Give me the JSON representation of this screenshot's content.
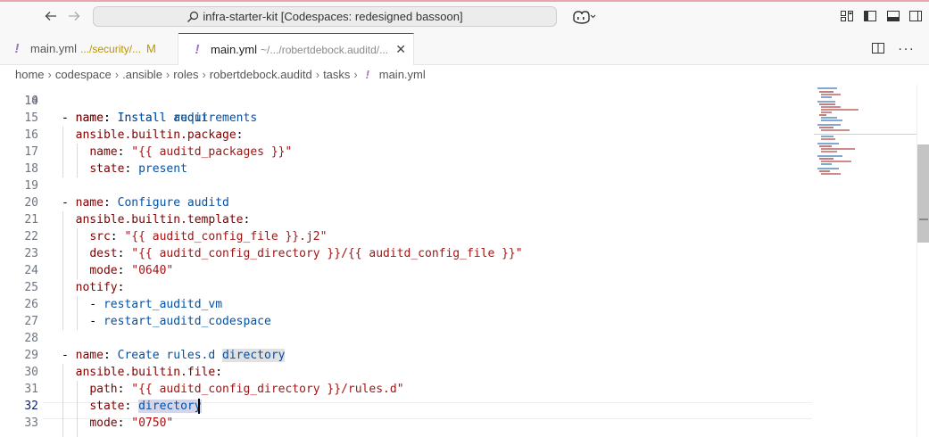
{
  "titlebar": {
    "search_text": "infra-starter-kit [Codespaces: redesigned bassoon]",
    "back_icon": "arrow-left-icon",
    "forward_icon": "arrow-right-icon"
  },
  "tabs": [
    {
      "name": "main.yml",
      "description": ".../security/...",
      "status": "M",
      "active": false
    },
    {
      "name": "main.yml",
      "description": "~/.../robertdebock.auditd/...",
      "status": "",
      "active": true
    }
  ],
  "breadcrumb": [
    "home",
    "codespace",
    ".ansible",
    "roles",
    "robertdebock.auditd",
    "tasks",
    "main.yml"
  ],
  "editor": {
    "partial_top_line": "10",
    "partial_top_text": "- name: Install requirements",
    "lines": [
      {
        "n": "14",
        "text": ""
      },
      {
        "n": "15",
        "text": "- name: Install audit"
      },
      {
        "n": "16",
        "text": "  ansible.builtin.package:"
      },
      {
        "n": "17",
        "text": "    name: \"{{ auditd_packages }}\""
      },
      {
        "n": "18",
        "text": "    state: present"
      },
      {
        "n": "19",
        "text": ""
      },
      {
        "n": "20",
        "text": "- name: Configure auditd"
      },
      {
        "n": "21",
        "text": "  ansible.builtin.template:"
      },
      {
        "n": "22",
        "text": "    src: \"{{ auditd_config_file }}.j2\""
      },
      {
        "n": "23",
        "text": "    dest: \"{{ auditd_config_directory }}/{{ auditd_config_file }}\""
      },
      {
        "n": "24",
        "text": "    mode: \"0640\""
      },
      {
        "n": "25",
        "text": "  notify:"
      },
      {
        "n": "26",
        "text": "    - restart_auditd_vm"
      },
      {
        "n": "27",
        "text": "    - restart_auditd_codespace"
      },
      {
        "n": "28",
        "text": ""
      },
      {
        "n": "29",
        "text": "- name: Create rules.d directory"
      },
      {
        "n": "30",
        "text": "  ansible.builtin.file:"
      },
      {
        "n": "31",
        "text": "    path: \"{{ auditd_config_directory }}/rules.d\""
      },
      {
        "n": "32",
        "text": "    state: directory"
      },
      {
        "n": "33",
        "text": "    mode: \"0750\""
      }
    ],
    "active_line": "32",
    "highlight_word": "directory"
  },
  "colors": {
    "accent": "#005fb8",
    "yaml_key": "#800000",
    "yaml_string": "#a31515",
    "yaml_value": "#0451a5",
    "yaml_icon": "#a074c4"
  }
}
